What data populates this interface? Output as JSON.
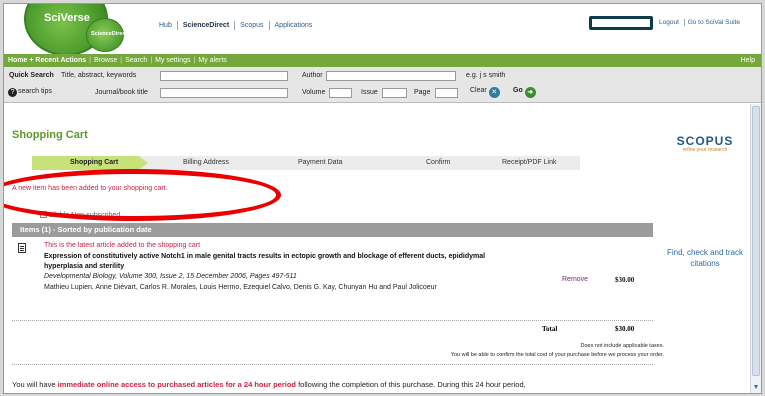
{
  "header": {
    "brand_main": "SciVerse",
    "brand_sub": "ScienceDirect",
    "nav": [
      "Hub",
      "ScienceDirect",
      "Scopus",
      "Applications"
    ],
    "top_links": [
      "Logout",
      "Go to SciVal Suite"
    ]
  },
  "green_nav": {
    "items": [
      "Home + Recent Actions",
      "Browse",
      "Search",
      "My settings",
      "My alerts"
    ],
    "help": "Help"
  },
  "quick_search": {
    "title": "Quick Search",
    "title_hint": "Title, abstract, keywords",
    "author_label": "Author",
    "author_example": "e.g. j s smith",
    "search_tips": "search tips",
    "journal_label": "Journal/book title",
    "volume_label": "Volume",
    "issue_label": "Issue",
    "page_label": "Page",
    "clear_label": "Clear",
    "go_label": "Go"
  },
  "page": {
    "title": "Shopping Cart",
    "steps": [
      "Shopping Cart",
      "Billing Address",
      "Payment Data",
      "Confirm",
      "Receipt/PDF Link"
    ],
    "message": "A new item has been added to your shopping cart.",
    "hidden_text": "ailable   Non-subscribed",
    "items_header": "Items (1) - Sorted by publication date"
  },
  "cart_item": {
    "latest_note": "This is the latest article added to the shopping cart",
    "title": "Expression of constitutively active Notch1 in male genital tracts results in ectopic growth and blockage of efferent ducts, epididymal hyperplasia and sterility",
    "journal": "Developmental Biology, Volume 300, Issue 2, 15 December 2006, Pages 497-511",
    "authors": "Mathieu Lupien, Anne Diévart, Carlos R. Morales, Louis Hermo, Ezequiel Calvo, Denis G. Kay, Chunyan Hu and Paul Jolicoeur",
    "remove": "Remove",
    "price": "$30.00"
  },
  "totals": {
    "label": "Total",
    "value": "$30.00",
    "tax_note": "Does not include applicable taxes.",
    "confirm_note": "You will be able to confirm the total cost of your purchase before we process your order."
  },
  "bottom": {
    "text_a": "You will have ",
    "text_red": "immediate online access to purchased articles for a 24 hour period",
    "text_b": " following the completion of this purchase. During this 24 hour period,"
  },
  "sidebar": {
    "scopus_logo": "SCOPUS",
    "scopus_tag": "refine your research",
    "find_text": "Find, check and track citations"
  },
  "colors": {
    "accent_green": "#74a83c",
    "title_green": "#5a9a2a",
    "alert_red": "#cc2244",
    "annotation_red": "#ea0000"
  }
}
